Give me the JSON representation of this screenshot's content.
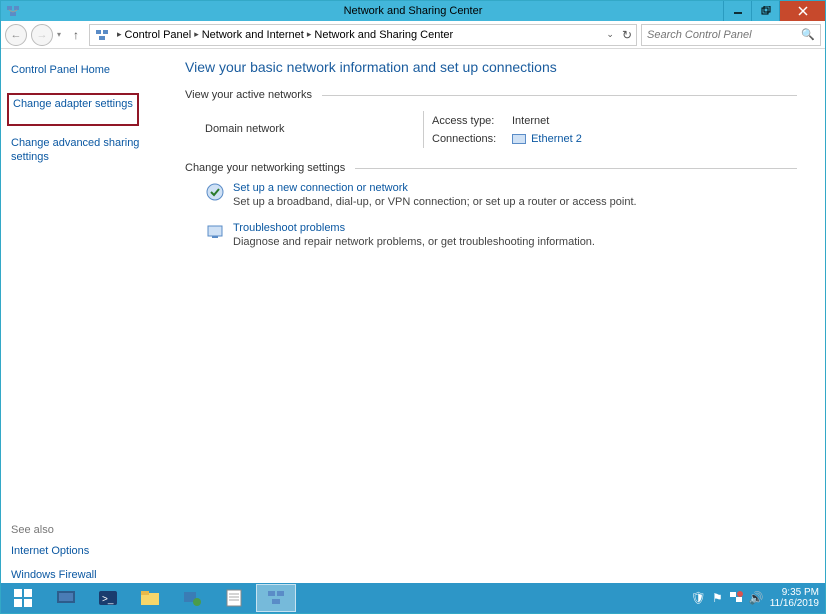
{
  "window": {
    "title": "Network and Sharing Center"
  },
  "breadcrumb": {
    "items": [
      "Control Panel",
      "Network and Internet",
      "Network and Sharing Center"
    ]
  },
  "search": {
    "placeholder": "Search Control Panel"
  },
  "sidebar": {
    "home": "Control Panel Home",
    "adapter": "Change adapter settings",
    "advanced": "Change advanced sharing settings",
    "see_also_label": "See also",
    "internet_options": "Internet Options",
    "firewall": "Windows Firewall"
  },
  "content": {
    "page_title": "View your basic network information and set up connections",
    "active_section": "View your active networks",
    "domain_label": "Domain network",
    "access_type_label": "Access type:",
    "access_type_value": "Internet",
    "connections_label": "Connections:",
    "connections_value": "Ethernet 2",
    "change_section": "Change your networking settings",
    "opt1_title": "Set up a new connection or network",
    "opt1_desc": "Set up a broadband, dial-up, or VPN connection; or set up a router or access point.",
    "opt2_title": "Troubleshoot problems",
    "opt2_desc": "Diagnose and repair network problems, or get troubleshooting information."
  },
  "taskbar": {
    "time": "9:35 PM",
    "date": "11/16/2019"
  }
}
